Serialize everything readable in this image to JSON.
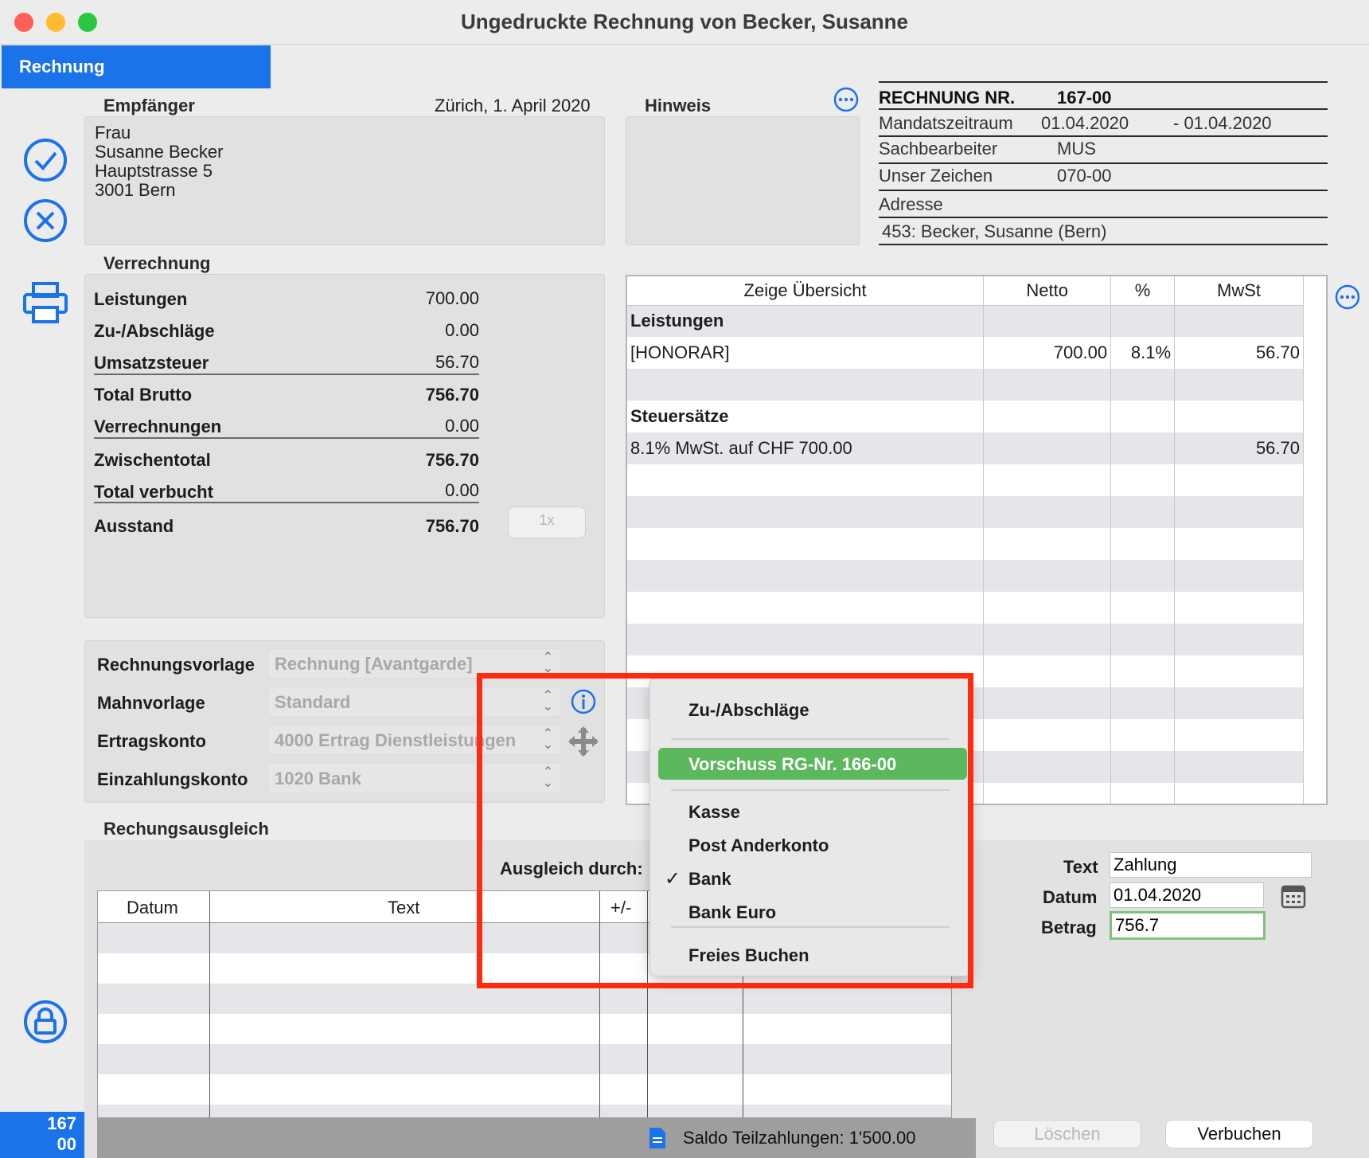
{
  "window": {
    "title": "Ungedruckte Rechnung von Becker, Susanne"
  },
  "tab": {
    "label": "Rechnung"
  },
  "recipient": {
    "heading": "Empfänger",
    "date_place": "Zürich, 1. April 2020",
    "lines": [
      "Frau",
      "Susanne Becker",
      "Hauptstrasse 5",
      "3001 Bern"
    ]
  },
  "hint": {
    "heading": "Hinweis"
  },
  "invoice_info": {
    "nr_label": "RECHNUNG NR.",
    "nr_value": "167-00",
    "period_label": "Mandatszeitraum",
    "period_from": "01.04.2020",
    "period_to": "- 01.04.2020",
    "clerk_label": "Sachbearbeiter",
    "clerk_value": "MUS",
    "ref_label": "Unser Zeichen",
    "ref_value": "070-00",
    "address_label": "Adresse",
    "address_value": "453: Becker, Susanne (Bern)"
  },
  "settlement": {
    "heading": "Verrechnung",
    "rows": [
      {
        "label": "Leistungen",
        "value": "700.00"
      },
      {
        "label": "Zu-/Abschläge",
        "value": "0.00"
      },
      {
        "label": "Umsatzsteuer",
        "value": "56.70"
      },
      {
        "label": "Total Brutto",
        "value": "756.70"
      },
      {
        "label": "Verrechnungen",
        "value": "0.00"
      },
      {
        "label": "Zwischentotal",
        "value": "756.70"
      },
      {
        "label": "Total verbucht",
        "value": "0.00"
      },
      {
        "label": "Ausstand",
        "value": "756.70"
      }
    ],
    "multiplier_button": "1x"
  },
  "overview": {
    "headers": [
      "Zeige Übersicht",
      "Netto",
      "%",
      "MwSt"
    ],
    "rows": [
      {
        "c0": "Leistungen",
        "c1": "",
        "c2": "",
        "c3": "",
        "bold": true
      },
      {
        "c0": "[HONORAR]",
        "c1": "700.00",
        "c2": "8.1%",
        "c3": "56.70"
      },
      {
        "c0": "",
        "c1": "",
        "c2": "",
        "c3": ""
      },
      {
        "c0": "Steuersätze",
        "c1": "",
        "c2": "",
        "c3": "",
        "bold": true
      },
      {
        "c0": "8.1% MwSt. auf CHF 700.00",
        "c1": "",
        "c2": "",
        "c3": "56.70"
      }
    ]
  },
  "templates": {
    "invoice_template_label": "Rechnungsvorlage",
    "invoice_template_value": "Rechnung [Avantgarde]",
    "dunning_label": "Mahnvorlage",
    "dunning_value": "Standard",
    "revenue_label": "Ertragskonto",
    "revenue_value": "4000 Ertrag Dienstleistungen",
    "deposit_label": "Einzahlungskonto",
    "deposit_value": "1020 Bank"
  },
  "payment": {
    "heading": "Rechungsausgleich",
    "method_label": "Ausgleich durch:",
    "table_headers": [
      "Datum",
      "Text",
      "+/-"
    ],
    "text_label": "Text",
    "text_value": "Zahlung",
    "date_label": "Datum",
    "date_value": "01.04.2020",
    "amount_label": "Betrag",
    "amount_value": "756.7",
    "delete_button": "Löschen",
    "book_button": "Verbuchen",
    "saldo": "Saldo Teilzahlungen: 1'500.00"
  },
  "menu": {
    "items": [
      "Zu-/Abschläge",
      "Vorschuss RG-Nr. 166-00",
      "Kasse",
      "Post Anderkonto",
      "Bank",
      "Bank Euro",
      "Freies Buchen"
    ],
    "checked_item": "Bank",
    "highlighted_item": "Vorschuss RG-Nr. 166-00"
  },
  "record_badge": {
    "line1": "167",
    "line2": "00"
  },
  "colors": {
    "accent": "#1a73e8",
    "highlight": "#5cb85c",
    "annotation": "#ff2a10"
  }
}
